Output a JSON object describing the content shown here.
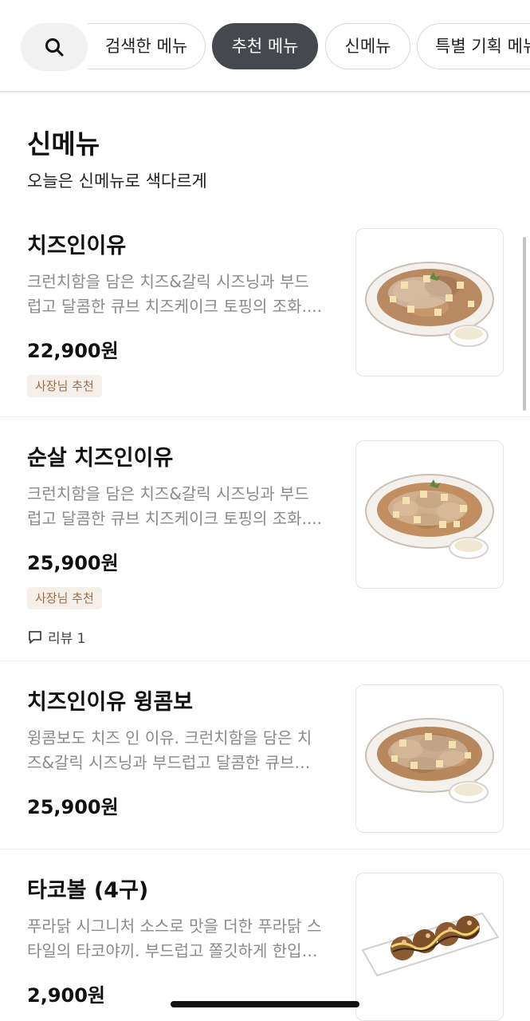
{
  "tabs": {
    "search_icon": "search-icon",
    "items": [
      {
        "label": "검색한 메뉴",
        "active": false
      },
      {
        "label": "추천 메뉴",
        "active": true
      },
      {
        "label": "신메뉴",
        "active": false
      },
      {
        "label": "특별 기획 메뉴",
        "active": false
      }
    ]
  },
  "section": {
    "title": "신메뉴",
    "subtitle": "오늘은 신메뉴로 색다르게"
  },
  "menu_items": [
    {
      "name": "치즈인이유",
      "description": "크런치함을 담은 치즈&갈릭 시즈닝과 부드\n럽고 달콤한 큐브 치즈케이크 토핑의 조화....",
      "price": "22,900원",
      "badge": "사장님 추천",
      "image": "fried-chicken-wings-cheese-cube-topping-photo"
    },
    {
      "name": "순살 치즈인이유",
      "description": "크런치함을 담은 치즈&갈릭 시즈닝과 부드\n럽고 달콤한 큐브 치즈케이크 토핑의 조화....",
      "price": "25,900원",
      "badge": "사장님 추천",
      "review": "리뷰 1",
      "image": "boneless-chicken-cheese-cube-topping-photo"
    },
    {
      "name": "치즈인이유 윙콤보",
      "description": "윙콤보도 치즈 인 이유. 크런치함을 담은 치\n즈&갈릭 시즈닝과 부드럽고 달콤한 큐브…",
      "price": "25,900원",
      "image": "wing-combo-cheese-cube-topping-photo"
    },
    {
      "name": "타코볼 (4구)",
      "description": "푸라닭 시그니처 소스로 맛을 더한 푸라닭 스\n타일의 타코야끼. 부드럽고 쫄깃하게 한입…",
      "price": "2,900원",
      "image": "takoyaki-four-pieces-photo"
    }
  ],
  "colors": {
    "active_chip": "#45484c",
    "badge_bg": "#f5efe9",
    "badge_text": "#9b6b47",
    "description": "#8a8a8a"
  }
}
